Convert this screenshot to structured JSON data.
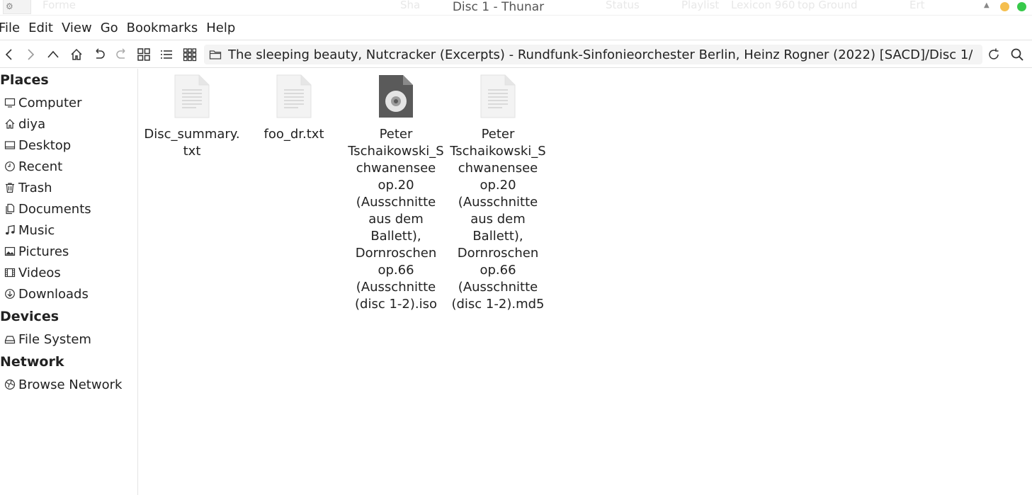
{
  "window": {
    "title": "Disc 1 - Thunar",
    "ghost_titles": [
      "Forme",
      "Sha",
      "Status",
      "Playlist",
      "Lexicon 960",
      "top Ground",
      "Ert"
    ],
    "colors": {
      "min": "#f5bf4f",
      "max": "#37c94a"
    }
  },
  "menubar": {
    "items": [
      "File",
      "Edit",
      "View",
      "Go",
      "Bookmarks",
      "Help"
    ]
  },
  "toolbar": {
    "buttons": [
      "back-icon",
      "forward-icon",
      "parent-icon",
      "home-icon",
      "undo-icon",
      "redo-icon",
      "icon-view-icon",
      "list-view-icon",
      "compact-view-icon",
      "reload-icon",
      "search-icon"
    ],
    "path": "The sleeping beauty, Nutcracker (Excerpts) - Rundfunk-Sinfonieorchester Berlin, Heinz Rogner (2022) [SACD]/Disc 1/"
  },
  "sidebar": {
    "places_heading": "Places",
    "places": [
      {
        "label": "Computer",
        "icon": "computer-icon"
      },
      {
        "label": "diya",
        "icon": "home-icon"
      },
      {
        "label": "Desktop",
        "icon": "desktop-icon"
      },
      {
        "label": "Recent",
        "icon": "recent-icon"
      },
      {
        "label": "Trash",
        "icon": "trash-icon"
      },
      {
        "label": "Documents",
        "icon": "documents-icon"
      },
      {
        "label": "Music",
        "icon": "music-icon"
      },
      {
        "label": "Pictures",
        "icon": "pictures-icon"
      },
      {
        "label": "Videos",
        "icon": "videos-icon"
      },
      {
        "label": "Downloads",
        "icon": "downloads-icon"
      }
    ],
    "devices_heading": "Devices",
    "devices": [
      {
        "label": "File System",
        "icon": "drive-icon"
      }
    ],
    "network_heading": "Network",
    "network": [
      {
        "label": "Browse Network",
        "icon": "network-icon"
      }
    ]
  },
  "files": [
    {
      "name": "Disc_summary.txt",
      "icon": "text-file-icon"
    },
    {
      "name": "foo_dr.txt",
      "icon": "text-file-icon"
    },
    {
      "name": "Peter Tschaikowski_Schwanensee op.20 (Ausschnitte aus dem Ballett), Dornroschen op.66 (Ausschnitte (disc 1-2).iso",
      "icon": "disc-image-icon"
    },
    {
      "name": "Peter Tschaikowski_Schwanensee op.20 (Ausschnitte aus dem Ballett), Dornroschen op.66 (Ausschnitte (disc 1-2).md5",
      "icon": "text-file-icon"
    }
  ]
}
